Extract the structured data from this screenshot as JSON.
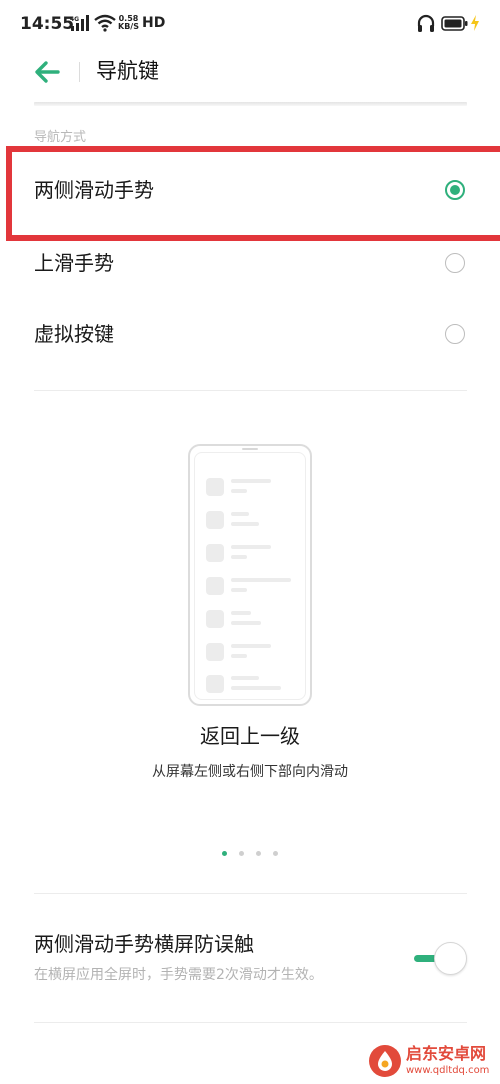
{
  "status_bar": {
    "time": "14:55",
    "network": "4G",
    "speed_value": "0.58",
    "speed_unit": "KB/S",
    "hd": "HD"
  },
  "header": {
    "title": "导航键"
  },
  "navigation": {
    "section_label": "导航方式",
    "options": [
      {
        "label": "两侧滑动手势",
        "selected": true
      },
      {
        "label": "上滑手势",
        "selected": false
      },
      {
        "label": "虚拟按键",
        "selected": false
      }
    ]
  },
  "illustration": {
    "caption_title": "返回上一级",
    "caption_subtitle": "从屏幕左侧或右侧下部向内滑动",
    "pages": 4,
    "active_page": 1
  },
  "setting": {
    "title": "两侧滑动手势横屏防误触",
    "description": "在横屏应用全屏时，手势需要2次滑动才生效。",
    "enabled": true
  },
  "watermark": {
    "name": "启东安卓网",
    "url": "www.qdltdq.com"
  },
  "colors": {
    "accent": "#2fb07c",
    "highlight": "#e2363b"
  }
}
